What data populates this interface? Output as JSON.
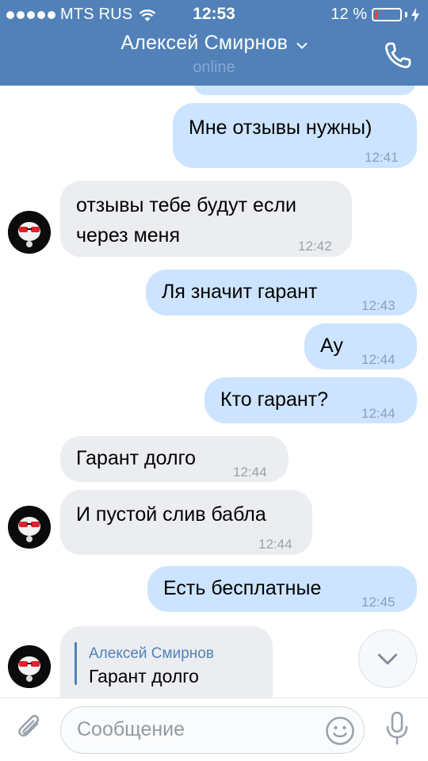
{
  "status_bar": {
    "carrier": "MTS RUS",
    "time": "12:53",
    "battery": "12 %",
    "battery_level": 0.12
  },
  "header": {
    "contact_name": "Алексей Смирнов",
    "presence": "online",
    "call_icon": "phone-icon"
  },
  "messages": [
    {
      "dir": "out",
      "text": "Мне отзывы нужны)",
      "time": "12:41"
    },
    {
      "dir": "in",
      "text": "отзывы тебе будут если\nчерез меня",
      "time": "12:42"
    },
    {
      "dir": "out",
      "text": "Ля значит гарант",
      "time": "12:43"
    },
    {
      "dir": "out",
      "text": "Ау",
      "time": "12:44"
    },
    {
      "dir": "out",
      "text": "Кто гарант?",
      "time": "12:44"
    },
    {
      "dir": "in",
      "text": "Гарант долго",
      "time": "12:44"
    },
    {
      "dir": "in",
      "text": "И пустой слив бабла",
      "time": "12:44"
    },
    {
      "dir": "out",
      "text": "Есть бесплатные",
      "time": "12:45"
    },
    {
      "dir": "in",
      "reply_author": "Алексей Смирнов",
      "reply_text": "Гарант долго"
    }
  ],
  "input": {
    "placeholder": "Сообщение",
    "icons": [
      "paperclip-icon",
      "smile-icon",
      "microphone-icon"
    ]
  },
  "colors": {
    "header": "#5181b8",
    "outgoing_bubble": "#cce4ff",
    "incoming_bubble": "#ebedf0",
    "battery_low": "#ff3b30"
  }
}
